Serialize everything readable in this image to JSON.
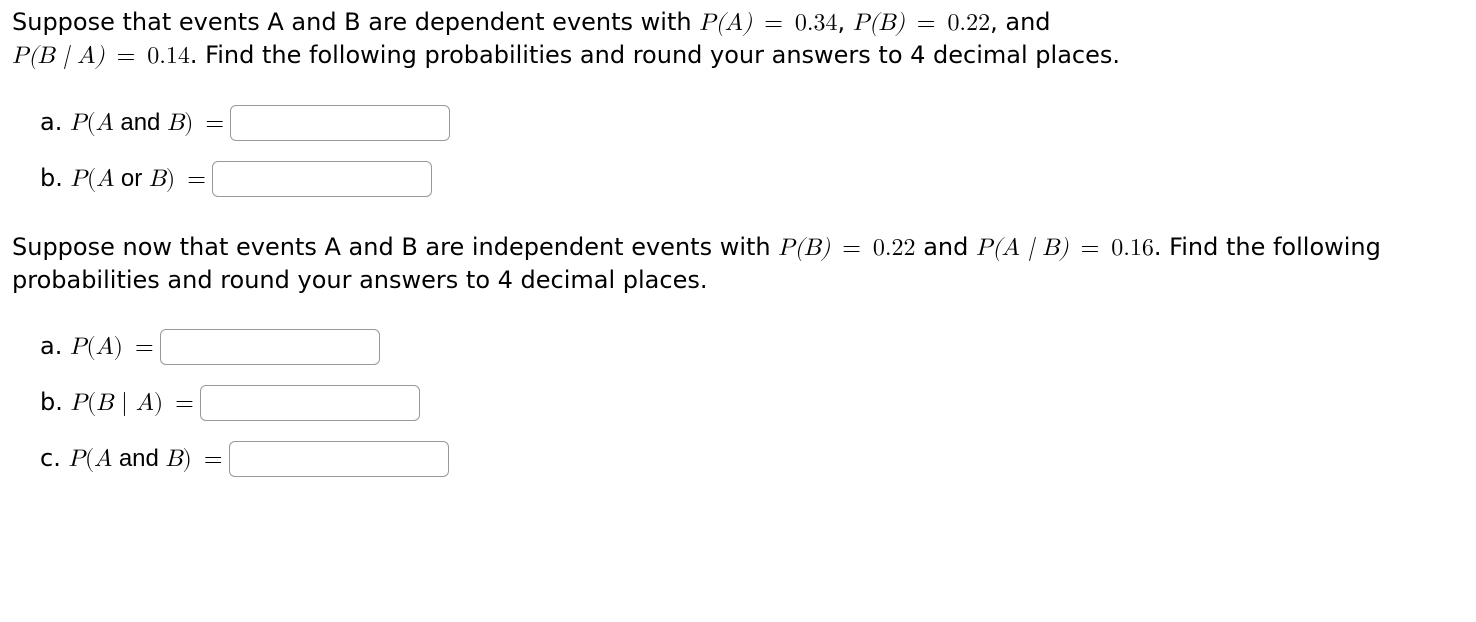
{
  "para1": {
    "pre": "Suppose that events A and B are dependent events with ",
    "pa_lbl": "P(A)",
    "eq1": " = ",
    "pa_val": "0.34",
    "comma1": ", ",
    "pb_lbl": "P(B)",
    "eq2": " = ",
    "pb_val": "0.22",
    "comma2": ", and",
    "pba_lbl": "P(B ∣ A)",
    "eq3": " = ",
    "pba_val": "0.14",
    "post": ". Find the following probabilities and round your answers to 4 decimal places."
  },
  "q1": {
    "a_letter": "a. ",
    "a_expr_P": "P",
    "a_expr_open": "(",
    "a_expr_A": "A",
    "a_expr_and": " and ",
    "a_expr_B": "B",
    "a_expr_close": ")",
    "a_eq": " =",
    "b_letter": "b. ",
    "b_expr_P": "P",
    "b_expr_open": "(",
    "b_expr_A": "A",
    "b_expr_or": " or ",
    "b_expr_B": "B",
    "b_expr_close": ")",
    "b_eq": " ="
  },
  "para2": {
    "pre": "Suppose now that events A and B are independent events with ",
    "pb_lbl": "P(B)",
    "eq1": " = ",
    "pb_val": "0.22",
    "and_word": " and ",
    "pab_lbl": "P(A ∣ B)",
    "eq2": " = ",
    "pab_val": "0.16",
    "post": ". Find the following probabilities and round your answers to 4 decimal places."
  },
  "q2": {
    "a_letter": "a. ",
    "a_expr_P": "P",
    "a_expr_open": "(",
    "a_expr_A": "A",
    "a_expr_close": ")",
    "a_eq": " =",
    "b_letter": "b. ",
    "b_expr_P": "P",
    "b_expr_open": "(",
    "b_expr_B": "B",
    "b_expr_bar": " ∣ ",
    "b_expr_A": "A",
    "b_expr_close": ")",
    "b_eq": " =",
    "c_letter": "c. ",
    "c_expr_P": "P",
    "c_expr_open": "(",
    "c_expr_A": "A",
    "c_expr_and": " and ",
    "c_expr_B": "B",
    "c_expr_close": ")",
    "c_eq": " ="
  }
}
